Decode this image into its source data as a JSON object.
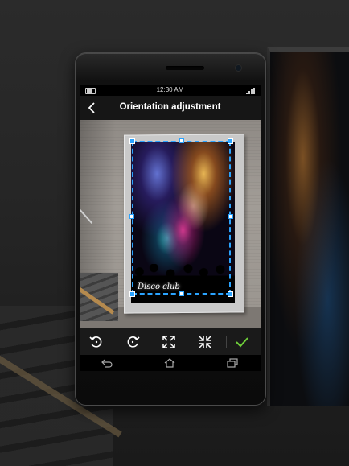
{
  "status_bar": {
    "time": "12:30 AM"
  },
  "header": {
    "title": "Orientation adjustment"
  },
  "poster": {
    "text": "Disco club"
  },
  "colors": {
    "accent": "#2aa3ff",
    "confirm": "#6fcf3a"
  },
  "toolbar": {
    "items": [
      {
        "name": "rotate-left-icon"
      },
      {
        "name": "rotate-right-icon"
      },
      {
        "name": "expand-icon"
      },
      {
        "name": "collapse-icon"
      },
      {
        "name": "checkmark-icon"
      }
    ]
  },
  "navbar": {
    "items": [
      "back-icon",
      "home-icon",
      "recent-apps-icon"
    ]
  }
}
